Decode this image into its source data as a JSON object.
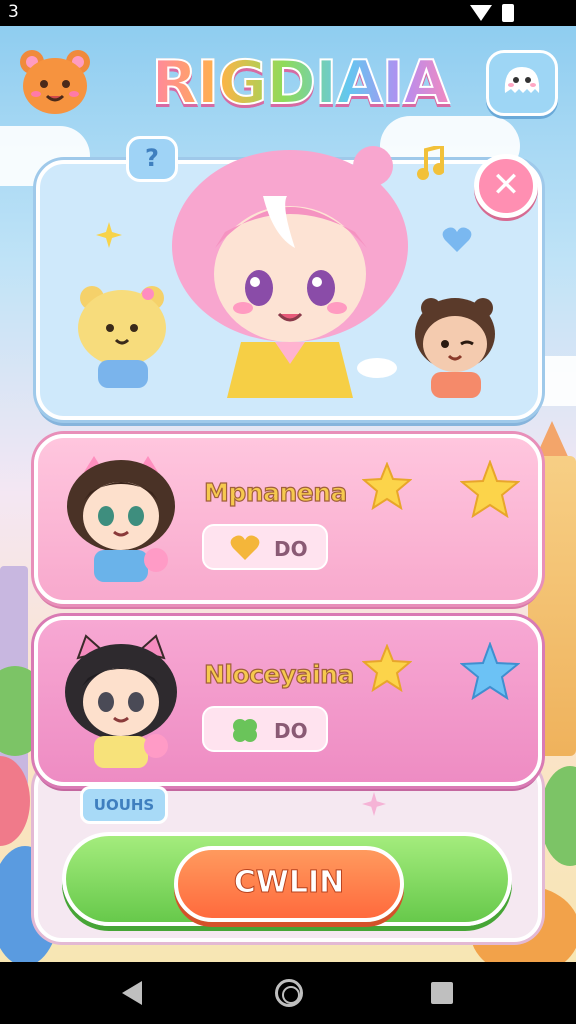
{
  "status_bar": {
    "time": "3"
  },
  "header": {
    "title": "RIGDIAIA",
    "help_label": "?"
  },
  "hero": {
    "close_label": "✕"
  },
  "players": [
    {
      "name": "Mpnanena",
      "stat_value": "DO"
    },
    {
      "name": "Nloceyaina",
      "stat_value": "DO"
    }
  ],
  "footer": {
    "small_tag_label": "UOUHS",
    "main_button_label": "CWLIN"
  },
  "colors": {
    "title_pink": "#ff7fb0",
    "card_pink": "#f8a9cd",
    "button_orange": "#ff6a3d",
    "bar_green": "#67c94b",
    "hero_blue": "#cfe9fb"
  },
  "icons": [
    "wifi-icon",
    "battery-icon",
    "bear-badge-icon",
    "ghost-chat-icon",
    "close-icon",
    "heart-icon",
    "clover-icon",
    "star-icon",
    "back-icon",
    "home-icon",
    "recents-icon"
  ]
}
